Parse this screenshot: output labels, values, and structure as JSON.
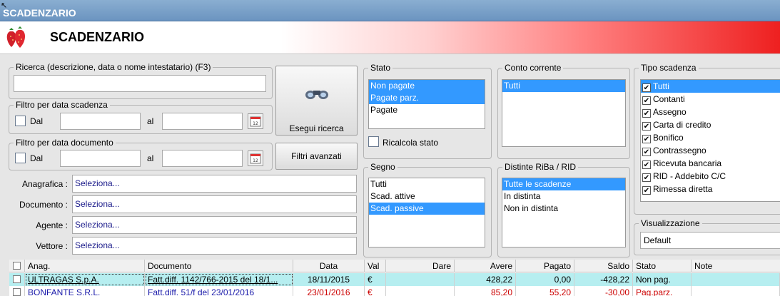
{
  "window": {
    "title": "SCADENZARIO"
  },
  "banner": {
    "title": "SCADENZARIO",
    "logo_icon": "strawberries-icon"
  },
  "search": {
    "legend": "Ricerca (descrizione, data o nome intestatario) (F3)",
    "value": ""
  },
  "filter_scadenza": {
    "legend": "Filtro per data scadenza",
    "dal_label": "Dal",
    "al_label": "al",
    "from": "",
    "to": ""
  },
  "filter_documento": {
    "legend": "Filtro per data documento",
    "dal_label": "Dal",
    "al_label": "al",
    "from": "",
    "to": ""
  },
  "buttons": {
    "search": "Esegui ricerca",
    "advanced": "Filtri avanzati"
  },
  "fields": [
    {
      "label": "Anagrafica :",
      "value": "Seleziona..."
    },
    {
      "label": "Documento :",
      "value": "Seleziona..."
    },
    {
      "label": "Agente :",
      "value": "Seleziona..."
    },
    {
      "label": "Vettore :",
      "value": "Seleziona..."
    }
  ],
  "stato": {
    "legend": "Stato",
    "items": [
      "Non pagate",
      "Pagate parz.",
      "Pagate"
    ],
    "selected": [
      0,
      1
    ],
    "recalc_label": "Ricalcola stato"
  },
  "segno": {
    "legend": "Segno",
    "items": [
      "Tutti",
      "Scad. attive",
      "Scad. passive"
    ],
    "selected": [
      2
    ]
  },
  "conto": {
    "legend": "Conto corrente",
    "items": [
      "Tutti"
    ],
    "selected": [
      0
    ]
  },
  "distinte": {
    "legend": "Distinte RiBa / RID",
    "items": [
      "Tutte le scadenze",
      "In distinta",
      "Non in distinta"
    ],
    "selected": [
      0
    ]
  },
  "tipo": {
    "legend": "Tipo scadenza",
    "items": [
      "Tutti",
      "Contanti",
      "Assegno",
      "Carta di credito",
      "Bonifico",
      "Contrassegno",
      "Ricevuta bancaria",
      "RID - Addebito C/C",
      "Rimessa diretta"
    ],
    "selected": [
      0
    ]
  },
  "visualizzazione": {
    "legend": "Visualizzazione",
    "value": "Default"
  },
  "table": {
    "columns": [
      "Anag.",
      "Documento",
      "Data",
      "Val",
      "Dare",
      "Avere",
      "Pagato",
      "Saldo",
      "Stato",
      "Note"
    ],
    "rows": [
      {
        "anag": "ULTRAGAS S.p.A.",
        "documento": "Fatt.diff. 1142/766-2015 del 18/1...",
        "data": "18/11/2015",
        "val": "€",
        "dare": "",
        "avere": "428,22",
        "pagato": "0,00",
        "saldo": "-428,22",
        "stato": "Non pag.",
        "note": ""
      },
      {
        "anag": "BONFANTE S.R.L.",
        "documento": "Fatt.diff. 51/f del 23/01/2016",
        "data": "23/01/2016",
        "val": "€",
        "dare": "",
        "avere": "85,20",
        "pagato": "55,20",
        "saldo": "-30,00",
        "stato": "Pag.parz.",
        "note": ""
      }
    ]
  },
  "colors": {
    "selection": "#3399ff",
    "row_highlight": "#b6eef0",
    "row_red": "#cc0000",
    "row_blue": "#1a1aaa",
    "titlebar": "#7aa0c8"
  }
}
